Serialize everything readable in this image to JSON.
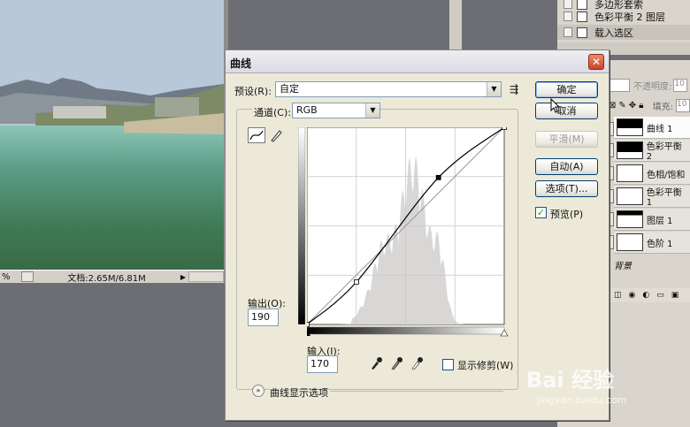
{
  "document": {
    "zoom": "%",
    "status": "文档:2.65M/6.81M"
  },
  "history": {
    "items": [
      {
        "label": "多边形套索"
      },
      {
        "label": "色彩平衡 2 图层"
      },
      {
        "label": "载入选区"
      }
    ]
  },
  "layers": {
    "opacity_label": "不透明度:",
    "opacity_value": "10",
    "fill_label": "填充:",
    "fill_value": "10",
    "items": [
      {
        "name": "曲线 1"
      },
      {
        "name": "色彩平衡 2"
      },
      {
        "name": "色相/饱和"
      },
      {
        "name": "色彩平衡 1"
      },
      {
        "name": "图层 1"
      },
      {
        "name": "色阶 1"
      }
    ],
    "background_label": "背景"
  },
  "dialog": {
    "title": "曲线",
    "close_label": "✕",
    "preset_label": "预设(R):",
    "preset_value": "自定",
    "channel_label": "通道(C):",
    "channel_value": "RGB",
    "output_label": "输出(O):",
    "output_value": "190",
    "input_label": "输入(I):",
    "input_value": "170",
    "show_clipping_label": "显示修剪(W)",
    "display_options_label": "曲线显示选项",
    "buttons": {
      "ok": "确定",
      "cancel": "取消",
      "smooth": "平滑(M)",
      "auto": "自动(A)",
      "options": "选项(T)..."
    },
    "preview_label": "预览(P)",
    "preview_checked": true
  },
  "watermark": {
    "logo": "Bai 经验",
    "url": "jingyan.baidu.com"
  },
  "curve": {
    "points": [
      [
        0,
        0
      ],
      [
        64,
        55
      ],
      [
        170,
        190
      ],
      [
        255,
        255
      ]
    ]
  }
}
